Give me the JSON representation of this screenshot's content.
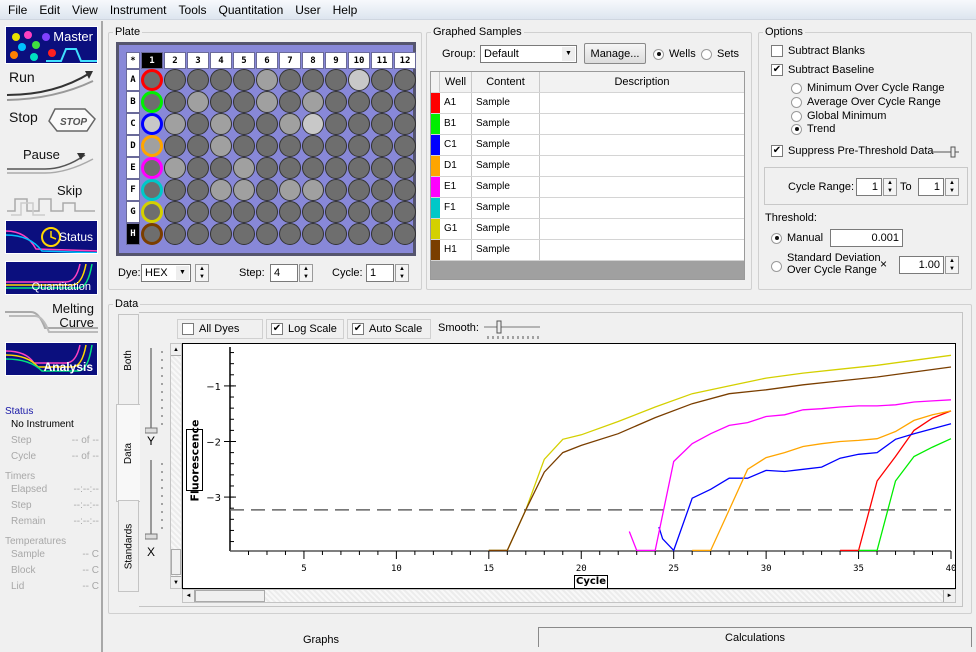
{
  "menu": [
    "File",
    "Edit",
    "View",
    "Instrument",
    "Tools",
    "Quantitation",
    "User",
    "Help"
  ],
  "sidebar": {
    "buttons": [
      {
        "label": "Master",
        "icon": "master-icon"
      },
      {
        "label": "Run",
        "icon": "run-icon"
      },
      {
        "label": "Stop",
        "icon": "stop-icon",
        "badge": "STOP"
      },
      {
        "label": "Pause",
        "icon": "pause-icon"
      },
      {
        "label": "Skip",
        "icon": "skip-icon"
      },
      {
        "label": "Status",
        "icon": "status-icon"
      },
      {
        "label": "Quantitation",
        "icon": "quantitation-icon"
      },
      {
        "label": "Melting Curve",
        "icon": "melting-curve-icon",
        "line1": "Melting",
        "line2": "Curve"
      },
      {
        "label": "Analysis",
        "icon": "analysis-icon"
      }
    ],
    "status": {
      "heading": "Status",
      "instrument": "No Instrument",
      "rows": [
        {
          "label": "Step",
          "value": "-- of --"
        },
        {
          "label": "Cycle",
          "value": "-- of --"
        }
      ],
      "timers_heading": "Timers",
      "timers": [
        {
          "label": "Elapsed",
          "value": "--:--:--"
        },
        {
          "label": "Step",
          "value": "--:--:--"
        },
        {
          "label": "Remain",
          "value": "--:--:--"
        }
      ],
      "temps_heading": "Temperatures",
      "temps": [
        {
          "label": "Sample",
          "value": "-- C"
        },
        {
          "label": "Block",
          "value": "-- C"
        },
        {
          "label": "Lid",
          "value": "-- C"
        }
      ]
    }
  },
  "plate": {
    "legend": "Plate",
    "corner": "*",
    "columns": [
      "1",
      "2",
      "3",
      "4",
      "5",
      "6",
      "7",
      "8",
      "9",
      "10",
      "11",
      "12"
    ],
    "rows": [
      "A",
      "B",
      "C",
      "D",
      "E",
      "F",
      "G",
      "H"
    ],
    "selected_column": "1",
    "selected_row": "H",
    "well_shades": [
      [
        "d",
        "d",
        "d",
        "d",
        "d",
        "m",
        "d",
        "d",
        "d",
        "l",
        "d",
        "d"
      ],
      [
        "d",
        "d",
        "m",
        "d",
        "d",
        "m",
        "d",
        "m",
        "d",
        "d",
        "d",
        "d"
      ],
      [
        "l",
        "m",
        "d",
        "m",
        "d",
        "d",
        "m",
        "l",
        "d",
        "d",
        "d",
        "d"
      ],
      [
        "m",
        "d",
        "d",
        "m",
        "d",
        "d",
        "d",
        "d",
        "d",
        "d",
        "d",
        "d"
      ],
      [
        "d",
        "m",
        "d",
        "d",
        "m",
        "d",
        "d",
        "d",
        "d",
        "d",
        "d",
        "d"
      ],
      [
        "d",
        "d",
        "d",
        "m",
        "m",
        "d",
        "m",
        "m",
        "d",
        "d",
        "d",
        "d"
      ],
      [
        "d",
        "d",
        "d",
        "d",
        "d",
        "d",
        "d",
        "d",
        "d",
        "d",
        "d",
        "d"
      ],
      [
        "d",
        "d",
        "d",
        "d",
        "d",
        "d",
        "d",
        "d",
        "d",
        "d",
        "d",
        "d"
      ]
    ],
    "shade_colors": {
      "d": "#6e6e6e",
      "m": "#a0a0a0",
      "l": "#c8c8c8"
    },
    "dye_label": "Dye:",
    "dye_value": "HEX",
    "step_label": "Step:",
    "step_value": "4",
    "cycle_label": "Cycle:",
    "cycle_value": "1"
  },
  "graphed_samples": {
    "legend": "Graphed Samples",
    "group_label": "Group:",
    "group_value": "Default",
    "manage_label": "Manage...",
    "wells_label": "Wells",
    "sets_label": "Sets",
    "selected_mode": "Wells",
    "headers": [
      "Well",
      "Content",
      "Description"
    ],
    "rows": [
      {
        "well": "A1",
        "content": "Sample",
        "description": "",
        "color": "#ff0000"
      },
      {
        "well": "B1",
        "content": "Sample",
        "description": "",
        "color": "#00ee00"
      },
      {
        "well": "C1",
        "content": "Sample",
        "description": "",
        "color": "#0000ff"
      },
      {
        "well": "D1",
        "content": "Sample",
        "description": "",
        "color": "#ffa500"
      },
      {
        "well": "E1",
        "content": "Sample",
        "description": "",
        "color": "#ff00ff"
      },
      {
        "well": "F1",
        "content": "Sample",
        "description": "",
        "color": "#00c8c8"
      },
      {
        "well": "G1",
        "content": "Sample",
        "description": "",
        "color": "#d4d000"
      },
      {
        "well": "H1",
        "content": "Sample",
        "description": "",
        "color": "#7a3e00"
      }
    ]
  },
  "options": {
    "legend": "Options",
    "subtract_blanks": {
      "label": "Subtract Blanks",
      "checked": false
    },
    "subtract_baseline": {
      "label": "Subtract Baseline",
      "checked": true
    },
    "baseline_methods": [
      {
        "label": "Minimum Over Cycle Range",
        "selected": false
      },
      {
        "label": "Average Over Cycle Range",
        "selected": false
      },
      {
        "label": "Global Minimum",
        "selected": false
      },
      {
        "label": "Trend",
        "selected": true
      }
    ],
    "suppress": {
      "label": "Suppress Pre-Threshold Data",
      "checked": true
    },
    "cycle_range_label": "Cycle Range:",
    "cycle_from": "1",
    "to_label": "To",
    "cycle_to": "1",
    "threshold_label": "Threshold:",
    "manual_label": "Manual",
    "manual_value": "0.001",
    "manual_selected": true,
    "stddev_line1": "Standard Deviation",
    "stddev_line2": "Over Cycle Range",
    "times": "×",
    "stddev_value": "1.00"
  },
  "data_panel": {
    "legend": "Data",
    "side_tabs": [
      "Both",
      "Data",
      "Standards"
    ],
    "active_side_tab": "Data",
    "all_dyes": {
      "label": "All Dyes",
      "checked": false
    },
    "log_scale": {
      "label": "Log Scale",
      "checked": true
    },
    "auto_scale": {
      "label": "Auto Scale",
      "checked": true
    },
    "smooth_label": "Smooth:",
    "y_slider_label": "Y",
    "x_slider_label": "X"
  },
  "bottom_tabs": [
    "Graphs",
    "Calculations"
  ],
  "active_bottom_tab": "Graphs",
  "chart_data": {
    "type": "line",
    "title": "",
    "xlabel": "Cycle",
    "ylabel": "Fluorescence",
    "xlim": [
      1,
      40
    ],
    "ylim": [
      -3.97,
      -0.3
    ],
    "xticks": [
      5,
      10,
      15,
      20,
      25,
      30,
      35,
      40
    ],
    "yticks": [
      -1,
      -2,
      -3
    ],
    "threshold": -3.23,
    "grid": false,
    "series": [
      {
        "name": "A1",
        "color": "#ff0000",
        "points": [
          [
            34,
            -3.96
          ],
          [
            35,
            -3.96
          ],
          [
            36,
            -2.71
          ],
          [
            37,
            -2.27
          ],
          [
            38,
            -1.8
          ],
          [
            39,
            -1.58
          ],
          [
            40,
            -1.45
          ]
        ]
      },
      {
        "name": "B1",
        "color": "#00ee00",
        "points": [
          [
            35,
            -3.96
          ],
          [
            36,
            -3.96
          ],
          [
            37,
            -2.71
          ],
          [
            38,
            -2.27
          ],
          [
            39,
            -2.1
          ],
          [
            40,
            -1.95
          ]
        ]
      },
      {
        "name": "C1",
        "color": "#0000ff",
        "points": [
          [
            24.2,
            -3.54
          ],
          [
            24.4,
            -3.75
          ],
          [
            25,
            -3.96
          ],
          [
            26,
            -3.02
          ],
          [
            27,
            -2.86
          ],
          [
            28,
            -2.66
          ],
          [
            29,
            -2.66
          ],
          [
            30,
            -2.52
          ],
          [
            31,
            -2.54
          ],
          [
            32,
            -2.5
          ],
          [
            33,
            -2.46
          ],
          [
            34,
            -2.3
          ],
          [
            35,
            -2.23
          ],
          [
            36,
            -2.2
          ],
          [
            37,
            -1.96
          ],
          [
            38,
            -1.86
          ],
          [
            39,
            -1.77
          ],
          [
            40,
            -1.68
          ]
        ]
      },
      {
        "name": "D1",
        "color": "#ffa500",
        "points": [
          [
            26,
            -3.96
          ],
          [
            27,
            -3.96
          ],
          [
            28,
            -3.23
          ],
          [
            29,
            -2.5
          ],
          [
            30,
            -2.29
          ],
          [
            31,
            -2.2
          ],
          [
            32,
            -2.09
          ],
          [
            33,
            -2.04
          ],
          [
            34,
            -2.0
          ],
          [
            35,
            -1.98
          ],
          [
            36,
            -1.95
          ],
          [
            37,
            -1.82
          ],
          [
            38,
            -1.62
          ],
          [
            39,
            -1.52
          ],
          [
            40,
            -1.45
          ]
        ]
      },
      {
        "name": "E1",
        "color": "#ff00ff",
        "points": [
          [
            22.6,
            -3.62
          ],
          [
            23,
            -3.96
          ],
          [
            24,
            -3.96
          ],
          [
            25,
            -2.36
          ],
          [
            26,
            -2.04
          ],
          [
            27,
            -1.86
          ],
          [
            28,
            -1.71
          ],
          [
            29,
            -1.66
          ],
          [
            30,
            -1.55
          ],
          [
            31,
            -1.52
          ],
          [
            32,
            -1.43
          ],
          [
            33,
            -1.41
          ],
          [
            34,
            -1.38
          ],
          [
            35,
            -1.36
          ],
          [
            36,
            -1.36
          ],
          [
            37,
            -1.34
          ],
          [
            38,
            -1.29
          ],
          [
            39,
            -1.27
          ],
          [
            40,
            -1.25
          ]
        ]
      },
      {
        "name": "G1",
        "color": "#d4d000",
        "points": [
          [
            15,
            -3.96
          ],
          [
            16,
            -3.96
          ],
          [
            17,
            -3.23
          ],
          [
            18,
            -2.32
          ],
          [
            19,
            -1.96
          ],
          [
            20,
            -1.88
          ],
          [
            22,
            -1.64
          ],
          [
            24,
            -1.38
          ],
          [
            26,
            -1.14
          ],
          [
            28,
            -1.0
          ],
          [
            30,
            -0.86
          ],
          [
            32,
            -0.77
          ],
          [
            34,
            -0.7
          ],
          [
            36,
            -0.63
          ],
          [
            38,
            -0.54
          ],
          [
            40,
            -0.45
          ]
        ]
      },
      {
        "name": "H1",
        "color": "#7a3e00",
        "points": [
          [
            15,
            -3.96
          ],
          [
            16,
            -3.96
          ],
          [
            17,
            -3.23
          ],
          [
            18,
            -2.55
          ],
          [
            19,
            -2.2
          ],
          [
            20,
            -2.07
          ],
          [
            22,
            -1.86
          ],
          [
            24,
            -1.57
          ],
          [
            26,
            -1.32
          ],
          [
            28,
            -1.14
          ],
          [
            30,
            -1.07
          ],
          [
            32,
            -0.98
          ],
          [
            34,
            -0.91
          ],
          [
            36,
            -0.84
          ],
          [
            38,
            -0.75
          ],
          [
            40,
            -0.66
          ]
        ]
      }
    ]
  }
}
